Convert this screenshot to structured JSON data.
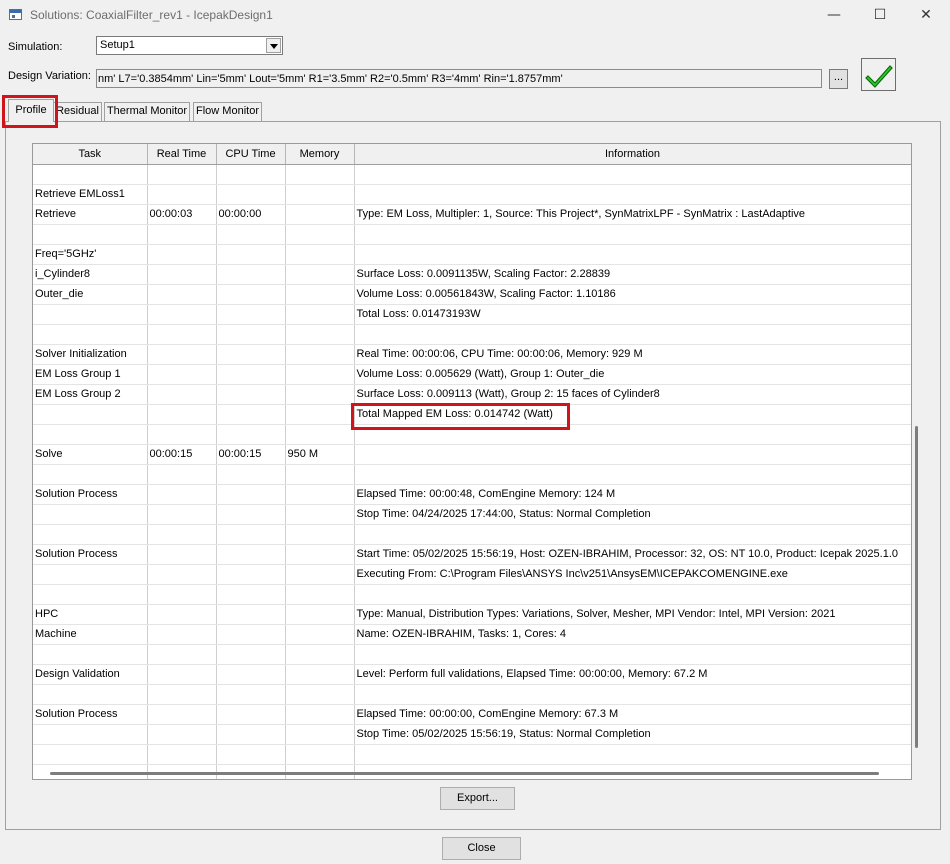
{
  "window": {
    "title": "Solutions: CoaxialFilter_rev1 - IcepakDesign1",
    "minimize_icon": "minimize-icon",
    "maximize_icon": "maximize-icon",
    "close_icon": "close-icon"
  },
  "simulation": {
    "label": "Simulation:",
    "value": "Setup1"
  },
  "design_variation": {
    "label": "Design Variation:",
    "value": "nm' L7='0.3854mm' Lin='5mm' Lout='5mm' R1='3.5mm' R2='0.5mm' R3='4mm' Rin='1.8757mm'",
    "browse_label": "...",
    "status_icon": "green-check-icon"
  },
  "tabs": [
    {
      "label": "Profile",
      "active": true
    },
    {
      "label": "Residual",
      "active": false
    },
    {
      "label": "Thermal Monitor",
      "active": false
    },
    {
      "label": "Flow Monitor",
      "active": false
    }
  ],
  "table": {
    "columns": [
      "Task",
      "Real Time",
      "CPU Time",
      "Memory",
      "Information"
    ],
    "rows": [
      [
        "",
        "",
        "",
        "",
        ""
      ],
      [
        "Retrieve EMLoss1",
        "",
        "",
        "",
        ""
      ],
      [
        "Retrieve",
        "00:00:03",
        "00:00:00",
        "",
        "Type: EM Loss, Multipler: 1, Source: This Project*, SynMatrixLPF - SynMatrix : LastAdaptive"
      ],
      [
        "",
        "",
        "",
        "",
        ""
      ],
      [
        "Freq='5GHz'",
        "",
        "",
        "",
        ""
      ],
      [
        "i_Cylinder8",
        "",
        "",
        "",
        "Surface Loss: 0.0091135W, Scaling Factor: 2.28839"
      ],
      [
        "Outer_die",
        "",
        "",
        "",
        "Volume Loss: 0.00561843W, Scaling Factor: 1.10186"
      ],
      [
        "",
        "",
        "",
        "",
        "Total Loss: 0.01473193W"
      ],
      [
        "",
        "",
        "",
        "",
        ""
      ],
      [
        "Solver Initialization",
        "",
        "",
        "",
        "Real Time: 00:00:06, CPU Time: 00:00:06, Memory: 929 M"
      ],
      [
        "EM Loss Group 1",
        "",
        "",
        "",
        "Volume Loss: 0.005629 (Watt), Group 1: Outer_die"
      ],
      [
        "EM Loss Group 2",
        "",
        "",
        "",
        "Surface Loss: 0.009113 (Watt), Group 2: 15 faces of Cylinder8"
      ],
      [
        "",
        "",
        "",
        "",
        "Total Mapped EM Loss: 0.014742 (Watt)"
      ],
      [
        "",
        "",
        "",
        "",
        ""
      ],
      [
        "Solve",
        "00:00:15",
        "00:00:15",
        "950 M",
        ""
      ],
      [
        "",
        "",
        "",
        "",
        ""
      ],
      [
        "Solution Process",
        "",
        "",
        "",
        "Elapsed Time: 00:00:48, ComEngine Memory: 124 M"
      ],
      [
        "",
        "",
        "",
        "",
        "Stop Time: 04/24/2025 17:44:00, Status: Normal Completion"
      ],
      [
        "",
        "",
        "",
        "",
        ""
      ],
      [
        "Solution Process",
        "",
        "",
        "",
        "Start Time: 05/02/2025 15:56:19, Host: OZEN-IBRAHIM, Processor: 32, OS: NT 10.0, Product: Icepak 2025.1.0"
      ],
      [
        "",
        "",
        "",
        "",
        "Executing From: C:\\Program Files\\ANSYS Inc\\v251\\AnsysEM\\ICEPAKCOMENGINE.exe"
      ],
      [
        "",
        "",
        "",
        "",
        ""
      ],
      [
        "HPC",
        "",
        "",
        "",
        "Type: Manual, Distribution Types: Variations, Solver, Mesher, MPI Vendor: Intel, MPI Version: 2021"
      ],
      [
        "Machine",
        "",
        "",
        "",
        "Name: OZEN-IBRAHIM, Tasks: 1, Cores: 4"
      ],
      [
        "",
        "",
        "",
        "",
        ""
      ],
      [
        "Design Validation",
        "",
        "",
        "",
        "Level: Perform full validations, Elapsed Time: 00:00:00, Memory: 67.2 M"
      ],
      [
        "",
        "",
        "",
        "",
        ""
      ],
      [
        "Solution Process",
        "",
        "",
        "",
        "Elapsed Time: 00:00:00, ComEngine Memory: 67.3 M"
      ],
      [
        "",
        "",
        "",
        "",
        "Stop Time: 05/02/2025 15:56:19, Status: Normal Completion"
      ],
      [
        "",
        "",
        "",
        "",
        ""
      ],
      [
        "",
        "",
        "",
        "",
        ""
      ]
    ]
  },
  "buttons": {
    "export": "Export...",
    "close": "Close"
  },
  "colors": {
    "highlight": "#d0141c",
    "check": "#2ecc2e"
  }
}
